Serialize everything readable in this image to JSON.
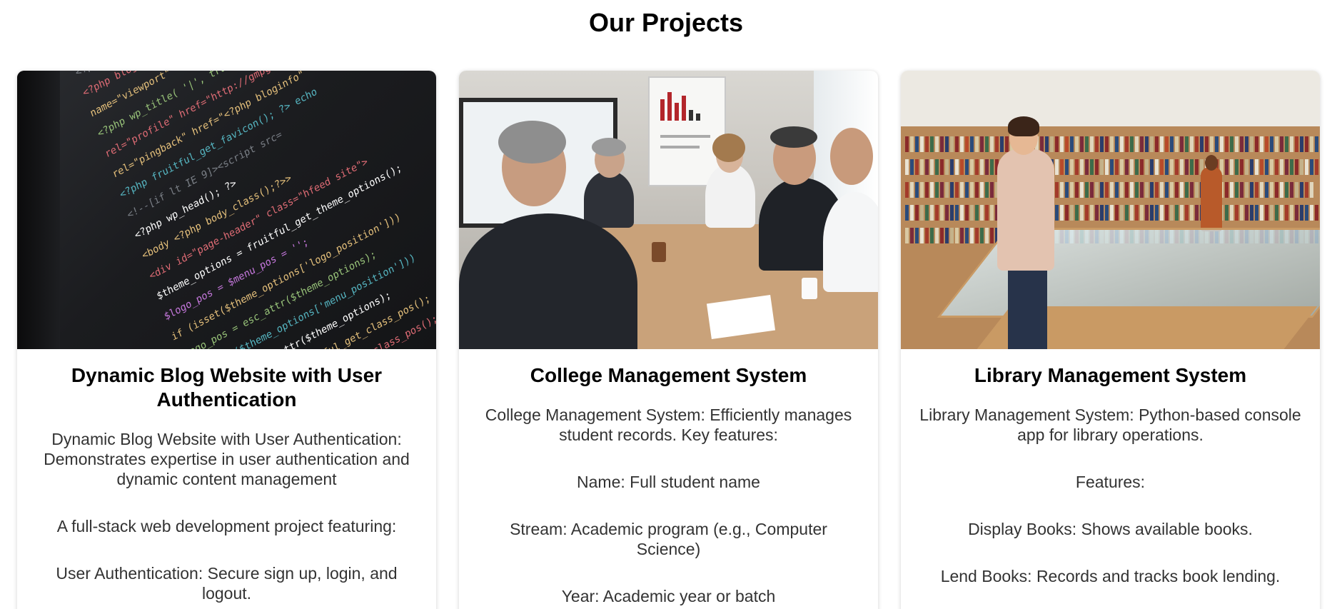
{
  "section": {
    "title": "Our Projects"
  },
  "projects": [
    {
      "title": "Dynamic Blog Website with User Authentication",
      "image_alt": "code-on-screen",
      "paragraphs": [
        "Dynamic Blog Website with User Authentication: Demonstrates expertise in user authentication and dynamic content management",
        "A full-stack web development project featuring:",
        "User Authentication: Secure sign up, login, and logout."
      ]
    },
    {
      "title": "College Management System",
      "image_alt": "business-meeting",
      "paragraphs": [
        "College Management System: Efficiently manages student records. Key features:",
        "Name: Full student name",
        "Stream: Academic program (e.g., Computer Science)",
        "Year: Academic year or batch"
      ]
    },
    {
      "title": "Library Management System",
      "image_alt": "library-bookshelves",
      "paragraphs": [
        "Library Management System: Python-based console app for library operations.",
        "Features:",
        "Display Books: Shows available books.",
        "Lend Books: Records and tracks book lending."
      ]
    }
  ]
}
